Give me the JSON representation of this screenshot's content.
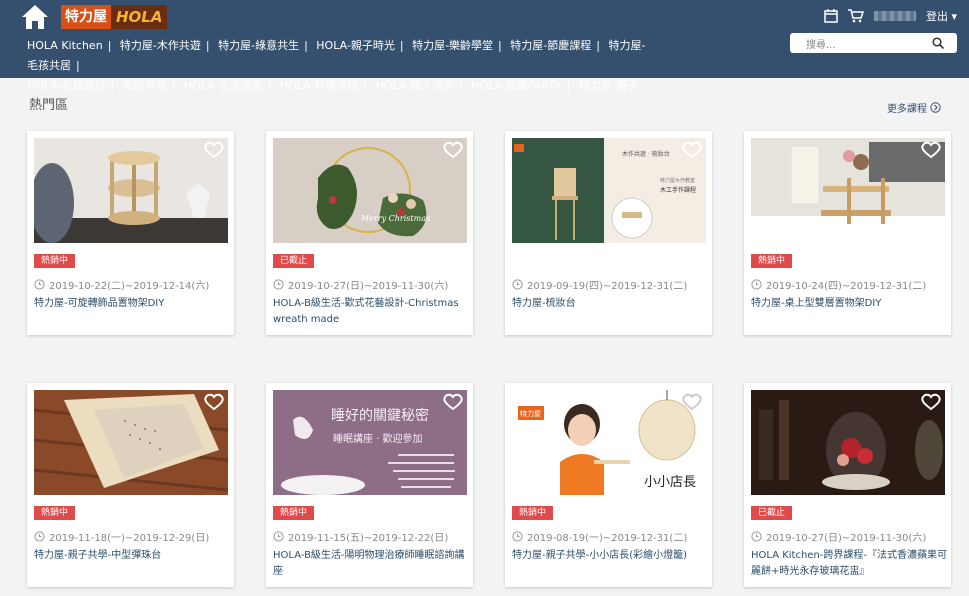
{
  "header": {
    "logo_brand": "特力屋",
    "logo_hola": "HOLA",
    "logout": "登出",
    "search_placeholder": "搜尋..."
  },
  "nav": {
    "row1": [
      "HOLA Kitchen",
      "特力屋-木作共遊",
      "特力屋-綠意共生",
      "HOLA-親子時光",
      "特力屋-樂齡學堂",
      "特力屋-節慶課程",
      "特力屋-毛孩共居"
    ],
    "row2": [
      "HOLA-花藝設計",
      "樂齡學堂",
      "HOLA-生活提案",
      "HOLA-料理烘焙",
      "HOLA-職人演示",
      "HOLA-節慶PARTY",
      "特力屋-親子共學"
    ]
  },
  "section": {
    "title": "熱門區",
    "more": "更多課程"
  },
  "cards": [
    {
      "badge": "熱銷中",
      "date": "2019-10-22(二)~2019-12-14(六)",
      "title": "特力屋-可旋轉飾品置物架DIY"
    },
    {
      "badge": "已截止",
      "date": "2019-10-27(日)~2019-11-30(六)",
      "title": "HOLA-B級生活-歡式花藝設計-Christmas wreath made",
      "img_text": "Merry Christmas"
    },
    {
      "badge": "",
      "date": "2019-09-19(四)~2019-12-31(二)",
      "title": "特力屋-梳妝台",
      "img_text1": "木作共遊 · 梳妝台",
      "img_text2": "特力屋木作教室",
      "img_text3": "木工手作課程"
    },
    {
      "badge": "熱銷中",
      "date": "2019-10-24(四)~2019-12-31(二)",
      "title": "特力屋-桌上型雙層置物架DIY"
    },
    {
      "badge": "熱銷中",
      "date": "2019-11-18(一)~2019-12-29(日)",
      "title": "特力屋-親子共學-中型彈珠台"
    },
    {
      "badge": "熱銷中",
      "date": "2019-11-15(五)~2019-12-22(日)",
      "title": "HOLA-B級生活-陽明物理治療師睡眠諮詢講座",
      "img_text1": "睡好的關鍵秘密",
      "img_text2": "睡眠講座 · 歡迎參加"
    },
    {
      "badge": "熱銷中",
      "date": "2019-08-19(一)~2019-12-31(二)",
      "title": "特力屋-親子共學-小小店長(彩繪小燈籠)",
      "img_text": "小小店長",
      "img_brand": "特力屋"
    },
    {
      "badge": "已截止",
      "date": "2019-10-27(日)~2019-11-30(六)",
      "title": "HOLA Kitchen-跨界課程-『法式香濃蘋果可麗餅+時光永存玻璃花盅』"
    }
  ],
  "colors": {
    "header_bg": "#34506e",
    "badge_red": "#e04a4a",
    "title_link": "#2d4f6a"
  }
}
